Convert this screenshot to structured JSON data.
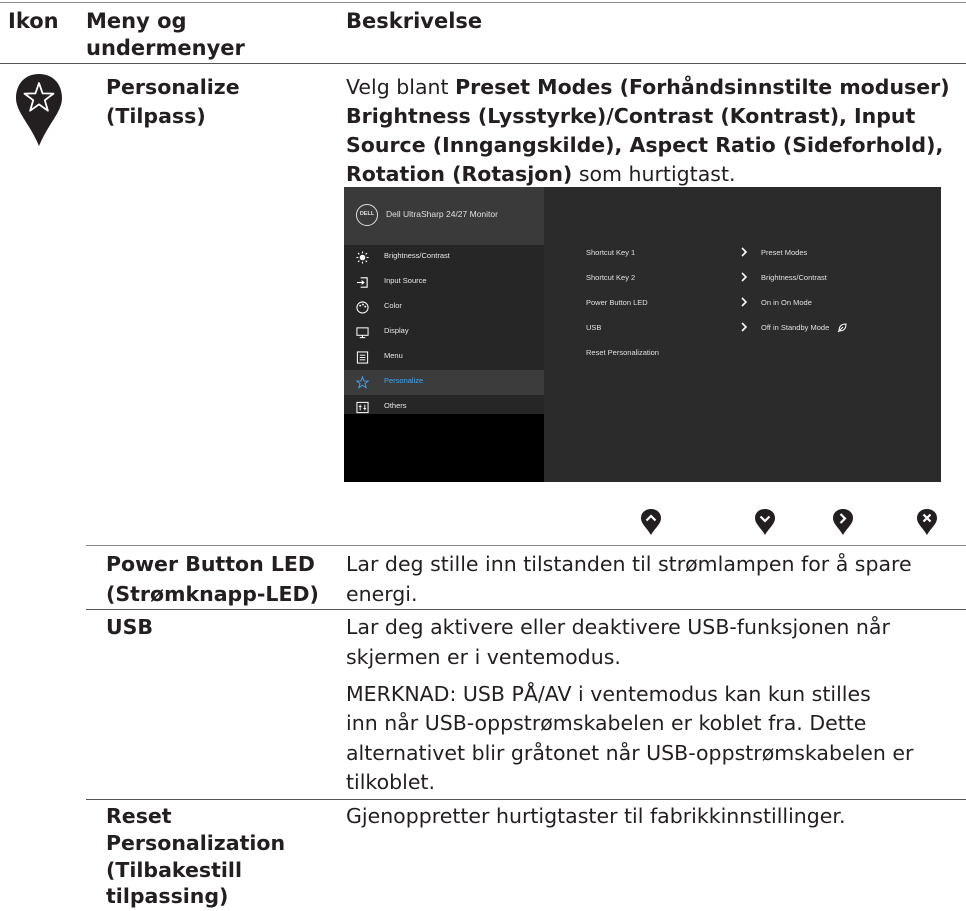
{
  "header": {
    "col_icon": "Ikon",
    "col_menu_line1": "Meny og",
    "col_menu_line2": "undermenyer",
    "col_desc": "Beskrivelse"
  },
  "personalize": {
    "label_line1": "Personalize",
    "label_line2": "(Tilpass)",
    "desc_line1_plain": "Velg blant ",
    "desc_line1_bold": "Preset Modes (Forhåndsinnstilte moduser)",
    "desc_line2_bold": "Brightness (Lysstyrke)/Contrast (Kontrast), Input",
    "desc_line3_bold": "Source (Inngangskilde), Aspect Ratio (Sideforhold),",
    "desc_line4_bold": "Rotation (Rotasjon)",
    "desc_line4_plain": " som hurtigtast."
  },
  "osd": {
    "brand": "DELL",
    "title": "Dell UltraSharp 24/27 Monitor",
    "menu": [
      {
        "label": "Brightness/Contrast",
        "icon": "brightness-icon"
      },
      {
        "label": "Input Source",
        "icon": "input-source-icon"
      },
      {
        "label": "Color",
        "icon": "color-palette-icon"
      },
      {
        "label": "Display",
        "icon": "display-icon"
      },
      {
        "label": "Menu",
        "icon": "menu-icon"
      },
      {
        "label": "Personalize",
        "icon": "star-icon",
        "selected": true
      },
      {
        "label": "Others",
        "icon": "others-icon"
      }
    ],
    "settings": [
      {
        "label": "Shortcut Key 1",
        "value": "Preset Modes"
      },
      {
        "label": "Shortcut Key 2",
        "value": "Brightness/Contrast"
      },
      {
        "label": "Power Button LED",
        "value": "On in On Mode"
      },
      {
        "label": "USB",
        "value": "Off in Standby Mode"
      },
      {
        "label": "Reset Personalization",
        "value": ""
      }
    ],
    "accent": "#3fa9f5"
  },
  "nav_buttons": [
    "chevron-up-icon",
    "chevron-down-icon",
    "chevron-right-icon",
    "close-icon"
  ],
  "rows": {
    "power_led": {
      "label_line1": "Power Button LED",
      "label_line2": "(Strømknapp-LED)",
      "desc_line1": "Lar deg stille inn tilstanden til strømlampen for å spare",
      "desc_line2": "energi."
    },
    "usb": {
      "label": "USB",
      "desc_line1": "Lar deg aktivere eller deaktivere USB-funksjonen når",
      "desc_line2": "skjermen er i ventemodus.",
      "note_line1": "MERKNAD: USB PÅ/AV i ventemodus kan kun stilles",
      "note_line2": "inn når USB-oppstrømskabelen er koblet fra. Dette",
      "note_line3": "alternativet blir gråtonet når USB-oppstrømskabelen er",
      "note_line4": "tilkoblet."
    },
    "reset": {
      "label_line1": "Reset",
      "label_line2": "Personalization",
      "label_line3": "(Tilbakestill",
      "label_line4": "tilpassing)",
      "desc": "Gjenoppretter hurtigtaster til fabrikkinnstillinger."
    }
  }
}
